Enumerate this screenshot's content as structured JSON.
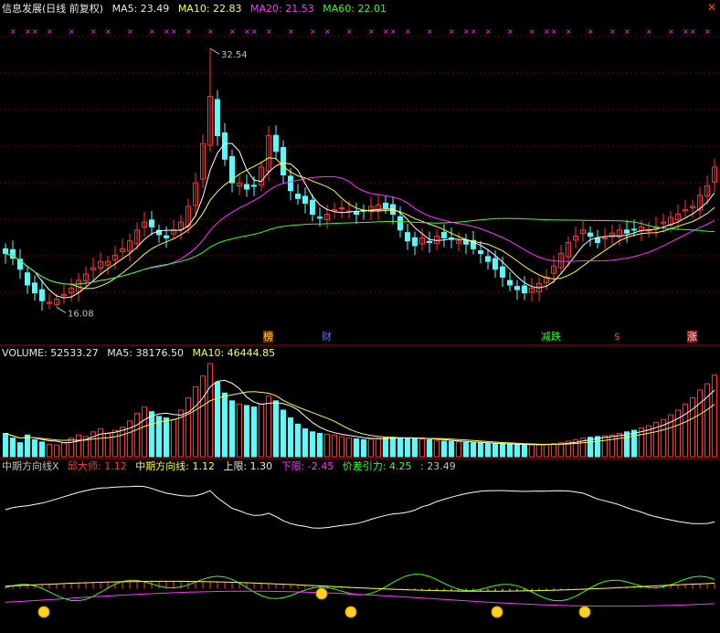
{
  "price_header": {
    "title": "信息发展(日线 前复权)",
    "ma5": "MA5: 23.49",
    "ma10": "MA10: 22.83",
    "ma20": "MA20: 21.53",
    "ma60": "MA60: 22.01"
  },
  "volume_header": {
    "volume": "VOLUME: 52533.27",
    "ma5": "MA5: 38176.50",
    "ma10": "MA10: 46444.85"
  },
  "indicator_header": {
    "name": "中期方向线X",
    "qiu": "邱大师: 1.12",
    "mid": "中期方向线: 1.12",
    "upper": "上限: 1.30",
    "lower": "下限: -2.45",
    "gravity": "价差引力: 4.25",
    "extra": ": 23.49"
  },
  "close_symbol": "✕",
  "events": [
    {
      "label": "榜",
      "color": "#ffd700",
      "bg": "#6a2a00",
      "i": 36
    },
    {
      "label": "财",
      "color": "#4f7dff",
      "bg": "",
      "i": 44
    },
    {
      "label": "减跌",
      "color": "#33ff33",
      "bg": "",
      "i": 74
    },
    {
      "label": "$",
      "color": "#ff3030",
      "bg": "",
      "i": 84
    },
    {
      "label": "涨",
      "color": "#ffd0d0",
      "bg": "#802020",
      "i": 94
    }
  ],
  "colors": {
    "up": "#ff3232",
    "down": "#54ffff",
    "ma5": "#ffffff",
    "ma10": "#ffff33",
    "ma20": "#ff33ff",
    "ma60": "#33ff33",
    "grid": "#7a0000",
    "separator": "#b00000",
    "vol_ma5": "#ffffff",
    "vol_ma10": "#ffff33"
  },
  "chart_data": {
    "type": "candlestick",
    "price_range": [
      15.0,
      34.0
    ],
    "high_label": "32.54",
    "low_label": "16.08",
    "high_index": 28,
    "low_index": 7,
    "closes": [
      19.5,
      19.2,
      18.5,
      17.5,
      17.0,
      16.5,
      16.4,
      16.6,
      16.9,
      17.3,
      17.8,
      18.2,
      18.6,
      19.0,
      19.0,
      19.4,
      19.8,
      20.3,
      21.0,
      21.5,
      21.2,
      20.7,
      20.5,
      21.0,
      21.5,
      22.5,
      24.0,
      26.5,
      29.5,
      27.0,
      25.5,
      24.0,
      24.0,
      23.6,
      23.8,
      25.0,
      27.0,
      26.0,
      24.5,
      23.5,
      23.0,
      22.7,
      22.0,
      21.8,
      22.0,
      22.3,
      22.4,
      22.2,
      22.0,
      22.2,
      22.5,
      22.6,
      22.4,
      22.0,
      21.0,
      20.3,
      20.0,
      20.5,
      20.2,
      20.6,
      20.5,
      20.4,
      20.3,
      20.1,
      19.8,
      19.5,
      19.0,
      18.5,
      18.0,
      17.5,
      17.2,
      17.0,
      17.3,
      17.6,
      18.0,
      18.7,
      19.5,
      20.2,
      20.6,
      21.0,
      20.6,
      20.2,
      20.5,
      20.8,
      21.0,
      20.8,
      21.0,
      21.2,
      21.0,
      21.2,
      21.5,
      21.8,
      22.0,
      22.3,
      22.5,
      23.2,
      23.8,
      25.0
    ],
    "volumes": [
      15000,
      12000,
      9000,
      14000,
      11000,
      9500,
      8000,
      7500,
      9000,
      12000,
      14000,
      13000,
      16000,
      18000,
      15000,
      17000,
      19000,
      23000,
      28000,
      32000,
      29000,
      26000,
      25000,
      24000,
      30000,
      38000,
      45000,
      52000,
      60000,
      48000,
      41000,
      36000,
      34000,
      33000,
      32000,
      34000,
      39000,
      36000,
      30000,
      25000,
      21000,
      18000,
      16000,
      15000,
      14500,
      14000,
      13000,
      12000,
      11500,
      11000,
      11500,
      12000,
      12200,
      12500,
      12200,
      12000,
      11800,
      11500,
      11000,
      10500,
      10000,
      9800,
      9500,
      9200,
      8900,
      8700,
      8500,
      8200,
      8000,
      7800,
      7700,
      7600,
      7700,
      7800,
      8000,
      8500,
      9000,
      10000,
      11000,
      12000,
      12500,
      13000,
      13500,
      14000,
      15000,
      16000,
      17000,
      18500,
      20000,
      22000,
      24000,
      27000,
      30000,
      34000,
      38000,
      43000,
      47000,
      52533.27
    ],
    "indicator": {
      "white_range": [
        0.5,
        1.1
      ],
      "low_range": [
        -2.6,
        1.8
      ]
    }
  }
}
